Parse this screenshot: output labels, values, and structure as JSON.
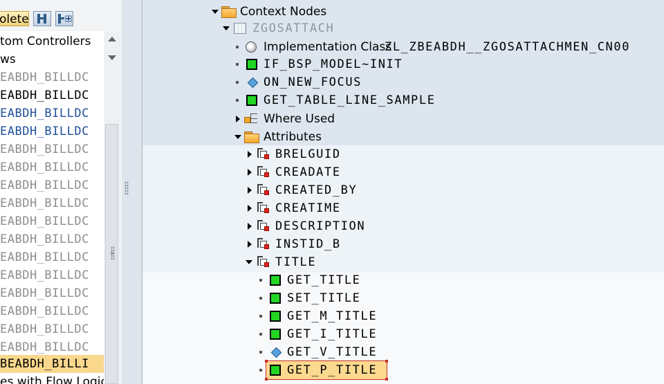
{
  "left_panel": {
    "toolbar": {
      "delete_label": "olete"
    },
    "headings": {
      "custom_controllers": "tom Controllers",
      "views": "ws",
      "pages_with_flow": "es with Flow Logic"
    },
    "view_rows": [
      {
        "label": "EABDH_BILLDC",
        "color": "#8d8d8d"
      },
      {
        "label": "EABDH_BILLDC",
        "color": "#000000"
      },
      {
        "label": "EABDH_BILLDC",
        "color": "#1f4f99"
      },
      {
        "label": "EABDH_BILLDC",
        "color": "#1f4f99"
      },
      {
        "label": "EABDH_BILLDC",
        "color": "#8d8d8d"
      },
      {
        "label": "EABDH_BILLDC",
        "color": "#8d8d8d"
      },
      {
        "label": "EABDH_BILLDC",
        "color": "#8d8d8d"
      },
      {
        "label": "EABDH_BILLDC",
        "color": "#8d8d8d"
      },
      {
        "label": "EABDH_BILLDC",
        "color": "#8d8d8d"
      },
      {
        "label": "EABDH_BILLDC",
        "color": "#8d8d8d"
      },
      {
        "label": "EABDH_BILLDC",
        "color": "#8d8d8d"
      },
      {
        "label": "EABDH_BILLDC",
        "color": "#8d8d8d"
      },
      {
        "label": "EABDH_BILLDC",
        "color": "#8d8d8d"
      },
      {
        "label": "EABDH_BILLDC",
        "color": "#8d8d8d"
      },
      {
        "label": "EABDH_BILLDC",
        "color": "#8d8d8d"
      },
      {
        "label": "EABDH_BILLDC",
        "color": "#8d8d8d"
      }
    ],
    "selected_row": "BEABDH_BILLI"
  },
  "tree": {
    "context_nodes": "Context Nodes",
    "node_name": "ZGOSATTACH",
    "impl_class_label": "Implementation Class",
    "impl_class_value": "ZL_ZBEABDH__ZGOSATTACHMEN_CN00",
    "if_init": "IF_BSP_MODEL~INIT",
    "on_new_focus": "ON_NEW_FOCUS",
    "get_table_line": "GET_TABLE_LINE_SAMPLE",
    "where_used": "Where Used",
    "attributes": "Attributes",
    "attr_list": [
      "BRELGUID",
      "CREADATE",
      "CREATED_BY",
      "CREATIME",
      "DESCRIPTION",
      "INSTID_B"
    ],
    "title_attr": "TITLE",
    "title_methods": [
      "GET_TITLE",
      "SET_TITLE",
      "GET_M_TITLE",
      "GET_I_TITLE",
      "GET_V_TITLE",
      "GET_P_TITLE"
    ]
  },
  "colors": {
    "band_blue": "#dde6ef",
    "band_light": "#eef3f8",
    "selection": "#fbd98e",
    "method_green": "#22d622"
  }
}
